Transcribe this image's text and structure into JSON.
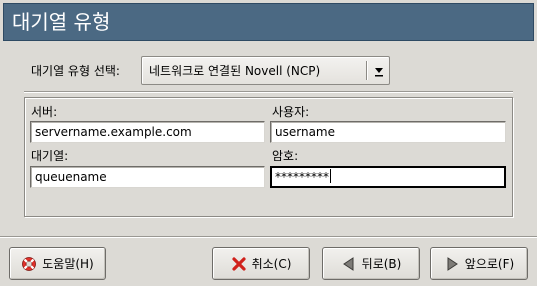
{
  "header": {
    "title": "대기열 유형"
  },
  "queue_type": {
    "label": "대기열 유형 선택:",
    "selected_value": "네트워크로 연결된 Novell (NCP)"
  },
  "form": {
    "server": {
      "label": "서버:",
      "value": "servername.example.com"
    },
    "user": {
      "label": "사용자:",
      "value": "username"
    },
    "queue": {
      "label": "대기열:",
      "value": "queuename"
    },
    "password": {
      "label": "암호:",
      "value": "*********"
    }
  },
  "buttons": {
    "help": {
      "label": "도움말(H)",
      "icon": "lifebuoy-icon"
    },
    "cancel": {
      "label": "취소(C)",
      "icon": "x-icon"
    },
    "back": {
      "label": "뒤로(B)",
      "icon": "arrow-left-icon"
    },
    "forward": {
      "label": "앞으로(F)",
      "icon": "arrow-right-icon"
    }
  },
  "colors": {
    "header_bg": "#4b6983",
    "window_bg": "#dcdad5",
    "cancel_icon": "#d0211b",
    "help_icon_ring": "#e0302a"
  }
}
